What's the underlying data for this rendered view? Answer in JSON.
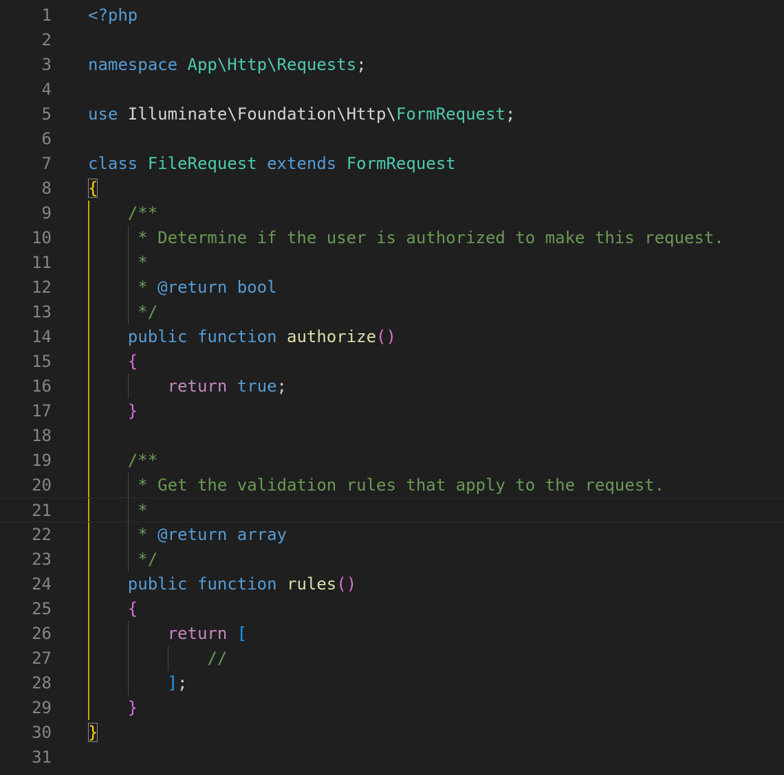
{
  "editor": {
    "colors": {
      "background": "#1f1f1f",
      "line_number": "#858585",
      "keyword": "#569cd6",
      "control": "#c586c0",
      "type": "#4ec9b0",
      "function": "#dcdcaa",
      "comment": "#6a9955",
      "text": "#d4d4d4",
      "bracket_level_1": "#ffd700",
      "bracket_level_2": "#da70d6",
      "bracket_level_3": "#179fff",
      "indent_guide_active": "#c9a800"
    },
    "active_line": 21,
    "lines": [
      {
        "n": "1",
        "tokens": [
          {
            "t": "<?php",
            "c": "kw"
          }
        ]
      },
      {
        "n": "2",
        "tokens": []
      },
      {
        "n": "3",
        "tokens": [
          {
            "t": "namespace ",
            "c": "kw"
          },
          {
            "t": "App\\Http\\Requests",
            "c": "type"
          },
          {
            "t": ";",
            "c": "txt"
          }
        ]
      },
      {
        "n": "4",
        "tokens": []
      },
      {
        "n": "5",
        "tokens": [
          {
            "t": "use ",
            "c": "kw"
          },
          {
            "t": "Illuminate\\Foundation\\Http\\",
            "c": "txt"
          },
          {
            "t": "FormRequest",
            "c": "type"
          },
          {
            "t": ";",
            "c": "txt"
          }
        ]
      },
      {
        "n": "6",
        "tokens": []
      },
      {
        "n": "7",
        "tokens": [
          {
            "t": "class ",
            "c": "kw"
          },
          {
            "t": "FileRequest ",
            "c": "type"
          },
          {
            "t": "extends ",
            "c": "kw"
          },
          {
            "t": "FormRequest",
            "c": "type"
          }
        ]
      },
      {
        "n": "8",
        "tokens": [
          {
            "t": "{",
            "c": "by",
            "box": true
          }
        ]
      },
      {
        "n": "9",
        "tokens": [
          {
            "t": "    /**",
            "c": "cm"
          }
        ]
      },
      {
        "n": "10",
        "tokens": [
          {
            "t": "     * Determine if the user is authorized to make this request.",
            "c": "cm"
          }
        ]
      },
      {
        "n": "11",
        "tokens": [
          {
            "t": "     *",
            "c": "cm"
          }
        ]
      },
      {
        "n": "12",
        "tokens": [
          {
            "t": "     * ",
            "c": "cm"
          },
          {
            "t": "@return ",
            "c": "kw"
          },
          {
            "t": "bool",
            "c": "kw"
          }
        ]
      },
      {
        "n": "13",
        "tokens": [
          {
            "t": "     */",
            "c": "cm"
          }
        ]
      },
      {
        "n": "14",
        "tokens": [
          {
            "t": "    public ",
            "c": "kw"
          },
          {
            "t": "function ",
            "c": "kw"
          },
          {
            "t": "authorize",
            "c": "fn"
          },
          {
            "t": "()",
            "c": "bp"
          }
        ]
      },
      {
        "n": "15",
        "tokens": [
          {
            "t": "    {",
            "c": "bp"
          }
        ]
      },
      {
        "n": "16",
        "tokens": [
          {
            "t": "        return ",
            "c": "ctl"
          },
          {
            "t": "true",
            "c": "kw"
          },
          {
            "t": ";",
            "c": "txt"
          }
        ]
      },
      {
        "n": "17",
        "tokens": [
          {
            "t": "    }",
            "c": "bp"
          }
        ]
      },
      {
        "n": "18",
        "tokens": []
      },
      {
        "n": "19",
        "tokens": [
          {
            "t": "    /**",
            "c": "cm"
          }
        ]
      },
      {
        "n": "20",
        "tokens": [
          {
            "t": "     * Get the validation rules that apply to the request.",
            "c": "cm"
          }
        ]
      },
      {
        "n": "21",
        "tokens": [
          {
            "t": "     *",
            "c": "cm"
          }
        ]
      },
      {
        "n": "22",
        "tokens": [
          {
            "t": "     * ",
            "c": "cm"
          },
          {
            "t": "@return ",
            "c": "kw"
          },
          {
            "t": "array",
            "c": "kw"
          }
        ]
      },
      {
        "n": "23",
        "tokens": [
          {
            "t": "     */",
            "c": "cm"
          }
        ]
      },
      {
        "n": "24",
        "tokens": [
          {
            "t": "    public ",
            "c": "kw"
          },
          {
            "t": "function ",
            "c": "kw"
          },
          {
            "t": "rules",
            "c": "fn"
          },
          {
            "t": "()",
            "c": "bp"
          }
        ]
      },
      {
        "n": "25",
        "tokens": [
          {
            "t": "    {",
            "c": "bp"
          }
        ]
      },
      {
        "n": "26",
        "tokens": [
          {
            "t": "        return ",
            "c": "ctl"
          },
          {
            "t": "[",
            "c": "bb"
          }
        ]
      },
      {
        "n": "27",
        "tokens": [
          {
            "t": "            //",
            "c": "cm"
          }
        ]
      },
      {
        "n": "28",
        "tokens": [
          {
            "t": "        ]",
            "c": "bb"
          },
          {
            "t": ";",
            "c": "txt"
          }
        ]
      },
      {
        "n": "29",
        "tokens": [
          {
            "t": "    }",
            "c": "bp"
          }
        ]
      },
      {
        "n": "30",
        "tokens": [
          {
            "t": "}",
            "c": "by",
            "box": true
          }
        ]
      },
      {
        "n": "31",
        "tokens": []
      }
    ]
  }
}
